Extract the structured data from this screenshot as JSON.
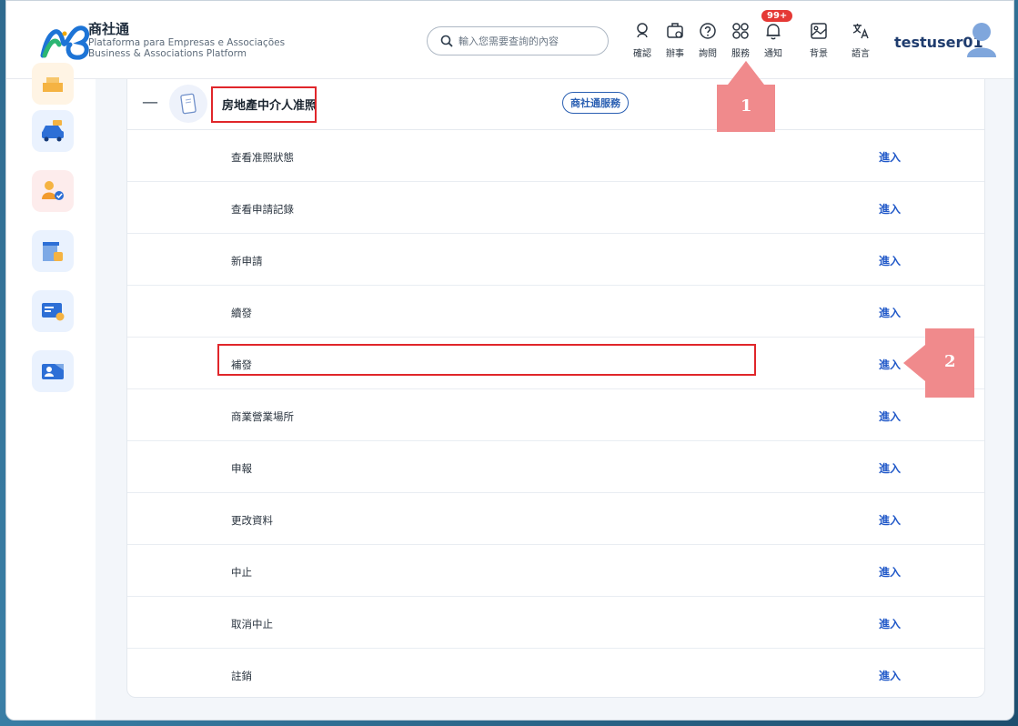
{
  "brand": {
    "title": "商社通",
    "subtitle_line1": "Plataforma para Empresas e Associações",
    "subtitle_line2": "Business & Associations Platform"
  },
  "search": {
    "placeholder": "輸入您需要查詢的內容"
  },
  "toolbar": [
    {
      "label": "確認",
      "icon": "confirm-icon"
    },
    {
      "label": "辦事",
      "icon": "briefcase-icon"
    },
    {
      "label": "詢問",
      "icon": "question-icon"
    },
    {
      "label": "服務",
      "icon": "services-grid-icon"
    },
    {
      "label": "通知",
      "icon": "bell-icon"
    },
    {
      "label": "背景",
      "icon": "image-icon"
    },
    {
      "label": "語言",
      "icon": "translate-icon"
    }
  ],
  "notification_badge": "99+",
  "user": {
    "name": "testuser01"
  },
  "service": {
    "collapse_symbol": "—",
    "title": "房地產中介人准照",
    "tag": "商社通服務"
  },
  "rows": [
    {
      "label": "查看准照狀態",
      "action": "進入"
    },
    {
      "label": "查看申請記錄",
      "action": "進入"
    },
    {
      "label": "新申請",
      "action": "進入"
    },
    {
      "label": "續發",
      "action": "進入"
    },
    {
      "label": "補發",
      "action": "進入"
    },
    {
      "label": "商業營業場所",
      "action": "進入"
    },
    {
      "label": "申報",
      "action": "進入"
    },
    {
      "label": "更改資料",
      "action": "進入"
    },
    {
      "label": "中止",
      "action": "進入"
    },
    {
      "label": "取消中止",
      "action": "進入"
    },
    {
      "label": "註銷",
      "action": "進入"
    }
  ],
  "annotations": {
    "step1": "1",
    "step2": "2"
  },
  "colors": {
    "accent": "#2058c8",
    "highlight": "#e0262a",
    "callout": "#f08a8c"
  }
}
